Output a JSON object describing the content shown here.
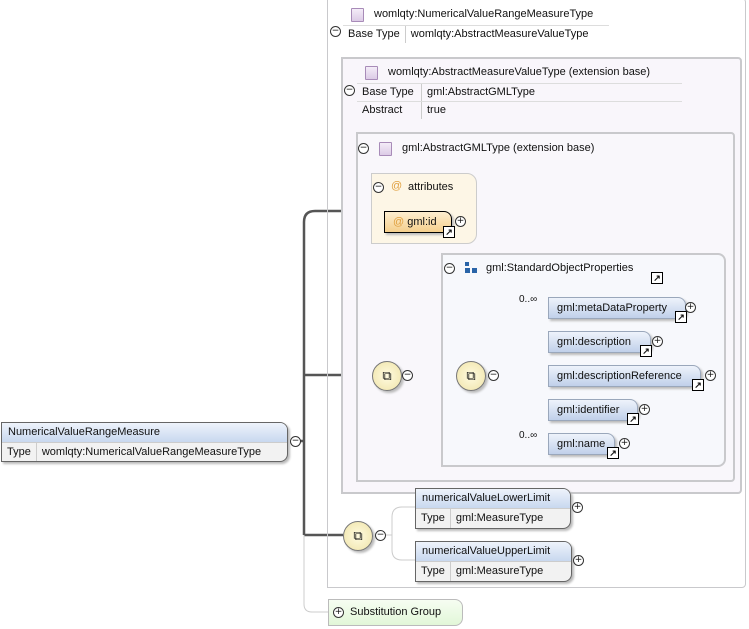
{
  "root": {
    "name": "NumericalValueRangeMeasure",
    "type_label": "Type",
    "type": "womlqty:NumericalValueRangeMeasureType"
  },
  "complex_type": {
    "name": "womlqty:NumericalValueRangeMeasureType",
    "base_label": "Base Type",
    "base": "womlqty:AbstractMeasureValueType"
  },
  "extension1": {
    "name": "womlqty:AbstractMeasureValueType (extension base)",
    "base_label": "Base Type",
    "base": "gml:AbstractGMLType",
    "abstract_label": "Abstract",
    "abstract": "true"
  },
  "extension2": {
    "name": "gml:AbstractGMLType (extension base)"
  },
  "attributes": {
    "label": "attributes",
    "items": [
      {
        "name": "gml:id"
      }
    ]
  },
  "group": {
    "name": "gml:StandardObjectProperties",
    "elements": [
      {
        "name": "gml:metaDataProperty",
        "occurs": "0..∞"
      },
      {
        "name": "gml:description",
        "occurs": ""
      },
      {
        "name": "gml:descriptionReference",
        "occurs": ""
      },
      {
        "name": "gml:identifier",
        "occurs": ""
      },
      {
        "name": "gml:name",
        "occurs": "0..∞"
      }
    ]
  },
  "local_elements": [
    {
      "name": "numericalValueLowerLimit",
      "type_label": "Type",
      "type": "gml:MeasureType"
    },
    {
      "name": "numericalValueUpperLimit",
      "type_label": "Type",
      "type": "gml:MeasureType"
    }
  ],
  "substitution": {
    "label": "Substitution Group"
  },
  "icons": {
    "collapse": "minus-circle",
    "expand": "plus-circle",
    "sequence": "sequence-compositor",
    "link": "goto-arrow"
  }
}
